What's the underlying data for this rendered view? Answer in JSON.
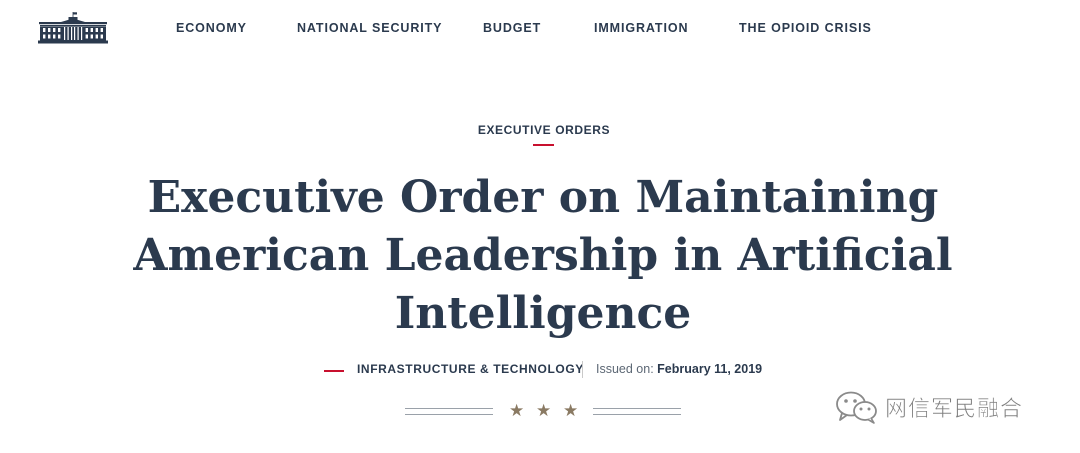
{
  "nav": {
    "items": [
      {
        "label": "ECONOMY"
      },
      {
        "label": "NATIONAL SECURITY"
      },
      {
        "label": "BUDGET"
      },
      {
        "label": "IMMIGRATION"
      },
      {
        "label": "THE OPIOID CRISIS"
      }
    ]
  },
  "article": {
    "kicker": "EXECUTIVE ORDERS",
    "title": "Executive Order on Maintaining American Leadership in Artificial Intelligence",
    "category": "INFRASTRUCTURE & TECHNOLOGY",
    "issued_label": "Issued on:",
    "issued_date": "February 11, 2019"
  },
  "ornament": {
    "stars": [
      "★",
      "★",
      "★"
    ]
  },
  "watermark": {
    "text": "网信军民融合"
  },
  "icons": {
    "logo": "white-house-logo-icon",
    "watermark": "wechat-icon"
  },
  "colors": {
    "navy": "#2b3a4e",
    "accent_red": "#c8102e",
    "star_gold": "#8a7a63",
    "rule_gray": "#9aa1a9"
  }
}
